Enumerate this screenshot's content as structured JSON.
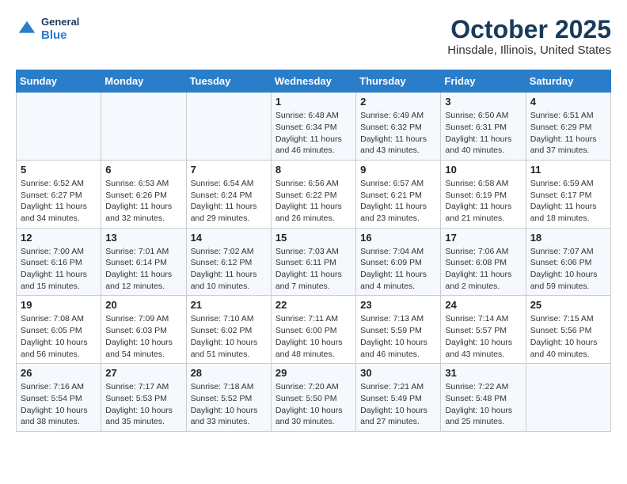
{
  "header": {
    "logo_general": "General",
    "logo_blue": "Blue",
    "title": "October 2025",
    "subtitle": "Hinsdale, Illinois, United States"
  },
  "days_of_week": [
    "Sunday",
    "Monday",
    "Tuesday",
    "Wednesday",
    "Thursday",
    "Friday",
    "Saturday"
  ],
  "weeks": [
    {
      "cells": [
        {
          "day": "",
          "info": ""
        },
        {
          "day": "",
          "info": ""
        },
        {
          "day": "",
          "info": ""
        },
        {
          "day": "1",
          "info": "Sunrise: 6:48 AM\nSunset: 6:34 PM\nDaylight: 11 hours and 46 minutes."
        },
        {
          "day": "2",
          "info": "Sunrise: 6:49 AM\nSunset: 6:32 PM\nDaylight: 11 hours and 43 minutes."
        },
        {
          "day": "3",
          "info": "Sunrise: 6:50 AM\nSunset: 6:31 PM\nDaylight: 11 hours and 40 minutes."
        },
        {
          "day": "4",
          "info": "Sunrise: 6:51 AM\nSunset: 6:29 PM\nDaylight: 11 hours and 37 minutes."
        }
      ]
    },
    {
      "cells": [
        {
          "day": "5",
          "info": "Sunrise: 6:52 AM\nSunset: 6:27 PM\nDaylight: 11 hours and 34 minutes."
        },
        {
          "day": "6",
          "info": "Sunrise: 6:53 AM\nSunset: 6:26 PM\nDaylight: 11 hours and 32 minutes."
        },
        {
          "day": "7",
          "info": "Sunrise: 6:54 AM\nSunset: 6:24 PM\nDaylight: 11 hours and 29 minutes."
        },
        {
          "day": "8",
          "info": "Sunrise: 6:56 AM\nSunset: 6:22 PM\nDaylight: 11 hours and 26 minutes."
        },
        {
          "day": "9",
          "info": "Sunrise: 6:57 AM\nSunset: 6:21 PM\nDaylight: 11 hours and 23 minutes."
        },
        {
          "day": "10",
          "info": "Sunrise: 6:58 AM\nSunset: 6:19 PM\nDaylight: 11 hours and 21 minutes."
        },
        {
          "day": "11",
          "info": "Sunrise: 6:59 AM\nSunset: 6:17 PM\nDaylight: 11 hours and 18 minutes."
        }
      ]
    },
    {
      "cells": [
        {
          "day": "12",
          "info": "Sunrise: 7:00 AM\nSunset: 6:16 PM\nDaylight: 11 hours and 15 minutes."
        },
        {
          "day": "13",
          "info": "Sunrise: 7:01 AM\nSunset: 6:14 PM\nDaylight: 11 hours and 12 minutes."
        },
        {
          "day": "14",
          "info": "Sunrise: 7:02 AM\nSunset: 6:12 PM\nDaylight: 11 hours and 10 minutes."
        },
        {
          "day": "15",
          "info": "Sunrise: 7:03 AM\nSunset: 6:11 PM\nDaylight: 11 hours and 7 minutes."
        },
        {
          "day": "16",
          "info": "Sunrise: 7:04 AM\nSunset: 6:09 PM\nDaylight: 11 hours and 4 minutes."
        },
        {
          "day": "17",
          "info": "Sunrise: 7:06 AM\nSunset: 6:08 PM\nDaylight: 11 hours and 2 minutes."
        },
        {
          "day": "18",
          "info": "Sunrise: 7:07 AM\nSunset: 6:06 PM\nDaylight: 10 hours and 59 minutes."
        }
      ]
    },
    {
      "cells": [
        {
          "day": "19",
          "info": "Sunrise: 7:08 AM\nSunset: 6:05 PM\nDaylight: 10 hours and 56 minutes."
        },
        {
          "day": "20",
          "info": "Sunrise: 7:09 AM\nSunset: 6:03 PM\nDaylight: 10 hours and 54 minutes."
        },
        {
          "day": "21",
          "info": "Sunrise: 7:10 AM\nSunset: 6:02 PM\nDaylight: 10 hours and 51 minutes."
        },
        {
          "day": "22",
          "info": "Sunrise: 7:11 AM\nSunset: 6:00 PM\nDaylight: 10 hours and 48 minutes."
        },
        {
          "day": "23",
          "info": "Sunrise: 7:13 AM\nSunset: 5:59 PM\nDaylight: 10 hours and 46 minutes."
        },
        {
          "day": "24",
          "info": "Sunrise: 7:14 AM\nSunset: 5:57 PM\nDaylight: 10 hours and 43 minutes."
        },
        {
          "day": "25",
          "info": "Sunrise: 7:15 AM\nSunset: 5:56 PM\nDaylight: 10 hours and 40 minutes."
        }
      ]
    },
    {
      "cells": [
        {
          "day": "26",
          "info": "Sunrise: 7:16 AM\nSunset: 5:54 PM\nDaylight: 10 hours and 38 minutes."
        },
        {
          "day": "27",
          "info": "Sunrise: 7:17 AM\nSunset: 5:53 PM\nDaylight: 10 hours and 35 minutes."
        },
        {
          "day": "28",
          "info": "Sunrise: 7:18 AM\nSunset: 5:52 PM\nDaylight: 10 hours and 33 minutes."
        },
        {
          "day": "29",
          "info": "Sunrise: 7:20 AM\nSunset: 5:50 PM\nDaylight: 10 hours and 30 minutes."
        },
        {
          "day": "30",
          "info": "Sunrise: 7:21 AM\nSunset: 5:49 PM\nDaylight: 10 hours and 27 minutes."
        },
        {
          "day": "31",
          "info": "Sunrise: 7:22 AM\nSunset: 5:48 PM\nDaylight: 10 hours and 25 minutes."
        },
        {
          "day": "",
          "info": ""
        }
      ]
    }
  ]
}
